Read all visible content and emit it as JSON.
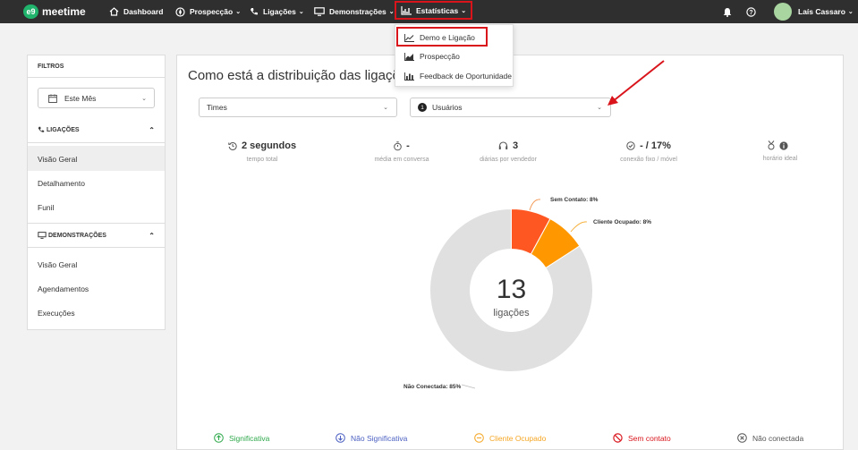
{
  "brand": {
    "logo_mark": "e9",
    "name": "meetime"
  },
  "nav": {
    "items": [
      {
        "label": "Dashboard",
        "icon": "home-icon"
      },
      {
        "label": "Prospecção",
        "icon": "compass-icon"
      },
      {
        "label": "Ligações",
        "icon": "phone-icon"
      },
      {
        "label": "Demonstrações",
        "icon": "monitor-icon"
      },
      {
        "label": "Estatísticas",
        "icon": "chart-icon"
      }
    ],
    "user_name": "Laís Cassaro"
  },
  "stats_menu": {
    "items": [
      {
        "label": "Demo e Ligação",
        "icon": "line-chart-icon"
      },
      {
        "label": "Prospecção",
        "icon": "area-chart-icon"
      },
      {
        "label": "Feedback de Oportunidade",
        "icon": "bar-chart-icon"
      }
    ]
  },
  "sidebar": {
    "title": "FILTROS",
    "period": "Este Mês",
    "calls_section": "LIGAÇÕES",
    "calls_links": [
      "Visão Geral",
      "Detalhamento",
      "Funil"
    ],
    "demos_section": "DEMONSTRAÇÕES",
    "demos_links": [
      "Visão Geral",
      "Agendamentos",
      "Execuções"
    ]
  },
  "main": {
    "title": "Como está a distribuição das ligaçõ",
    "teams_select": "Times",
    "users_select": "Usuários",
    "users_badge": "1",
    "stats": [
      {
        "value": "2 segundos",
        "label": "tempo total",
        "icon": "history-icon"
      },
      {
        "value": "-",
        "label": "média em conversa",
        "icon": "stopwatch-icon"
      },
      {
        "value": "3",
        "label": "diárias por vendedor",
        "icon": "headset-icon"
      },
      {
        "value": "- / 17%",
        "label": "conexão fixo / móvel",
        "icon": "check-circle-icon"
      },
      {
        "value": "",
        "label": "horário ideal",
        "icon": "medal-info-icon"
      }
    ]
  },
  "chart_data": {
    "type": "pie",
    "center_value": "13",
    "center_label": "ligações",
    "slices": [
      {
        "label": "Sem Contato: 8%",
        "value": 8,
        "color": "#ff5722"
      },
      {
        "label": "Cliente Ocupado: 8%",
        "value": 8,
        "color": "#ff9800"
      },
      {
        "label": "Não Conectada: 85%",
        "value": 85,
        "color": "#e0e0e0"
      }
    ],
    "legend": [
      {
        "label": "Significativa",
        "color": "#2ea84b",
        "icon": "arrow-up-circle-icon"
      },
      {
        "label": "Não Significativa",
        "color": "#4a5fc1",
        "icon": "arrow-down-circle-icon"
      },
      {
        "label": "Cliente Ocupado",
        "color": "#f5a623",
        "icon": "minus-circle-icon"
      },
      {
        "label": "Sem contato",
        "color": "#d9141b",
        "icon": "ban-icon"
      },
      {
        "label": "Não conectada",
        "color": "#555555",
        "icon": "x-circle-icon"
      }
    ]
  },
  "colors": {
    "topbar": "#2f2f2f",
    "brand": "#1fb36b",
    "annotation": "#d9141b"
  }
}
